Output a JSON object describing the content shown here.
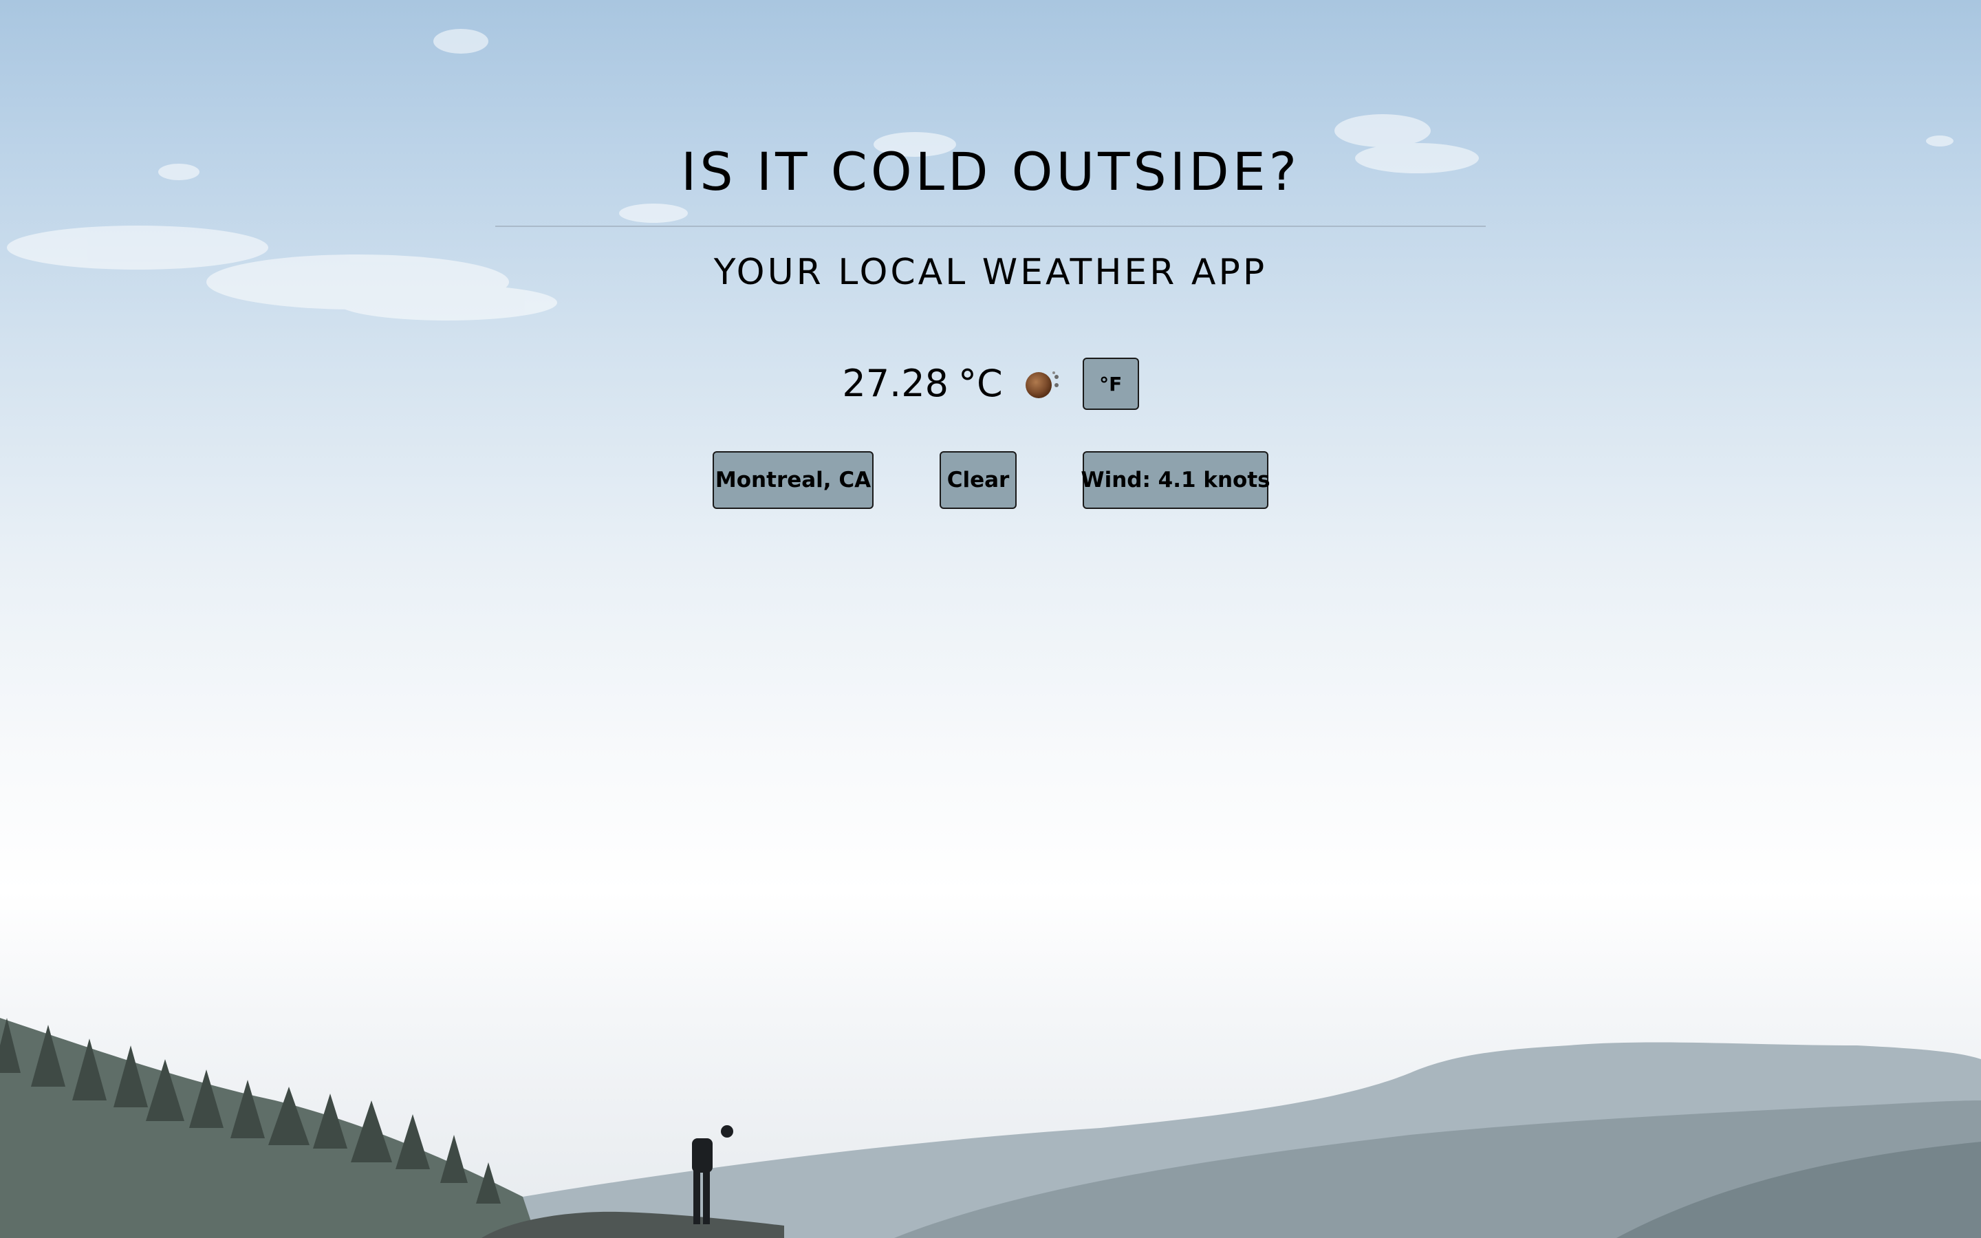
{
  "header": {
    "title": "IS IT COLD OUTSIDE?",
    "subtitle": "YOUR LOCAL WEATHER APP"
  },
  "weather": {
    "temperature": "27.28",
    "unit": "°C",
    "icon": "sun-haze-icon",
    "toggle_label": "°F",
    "location": "Montreal, CA",
    "condition": "Clear",
    "wind": "Wind: 4.1 knots"
  },
  "colors": {
    "button_bg": "#8fa3ae",
    "button_border": "#1a1a1a",
    "text": "#000000",
    "sky_top": "#a9c6e0"
  }
}
